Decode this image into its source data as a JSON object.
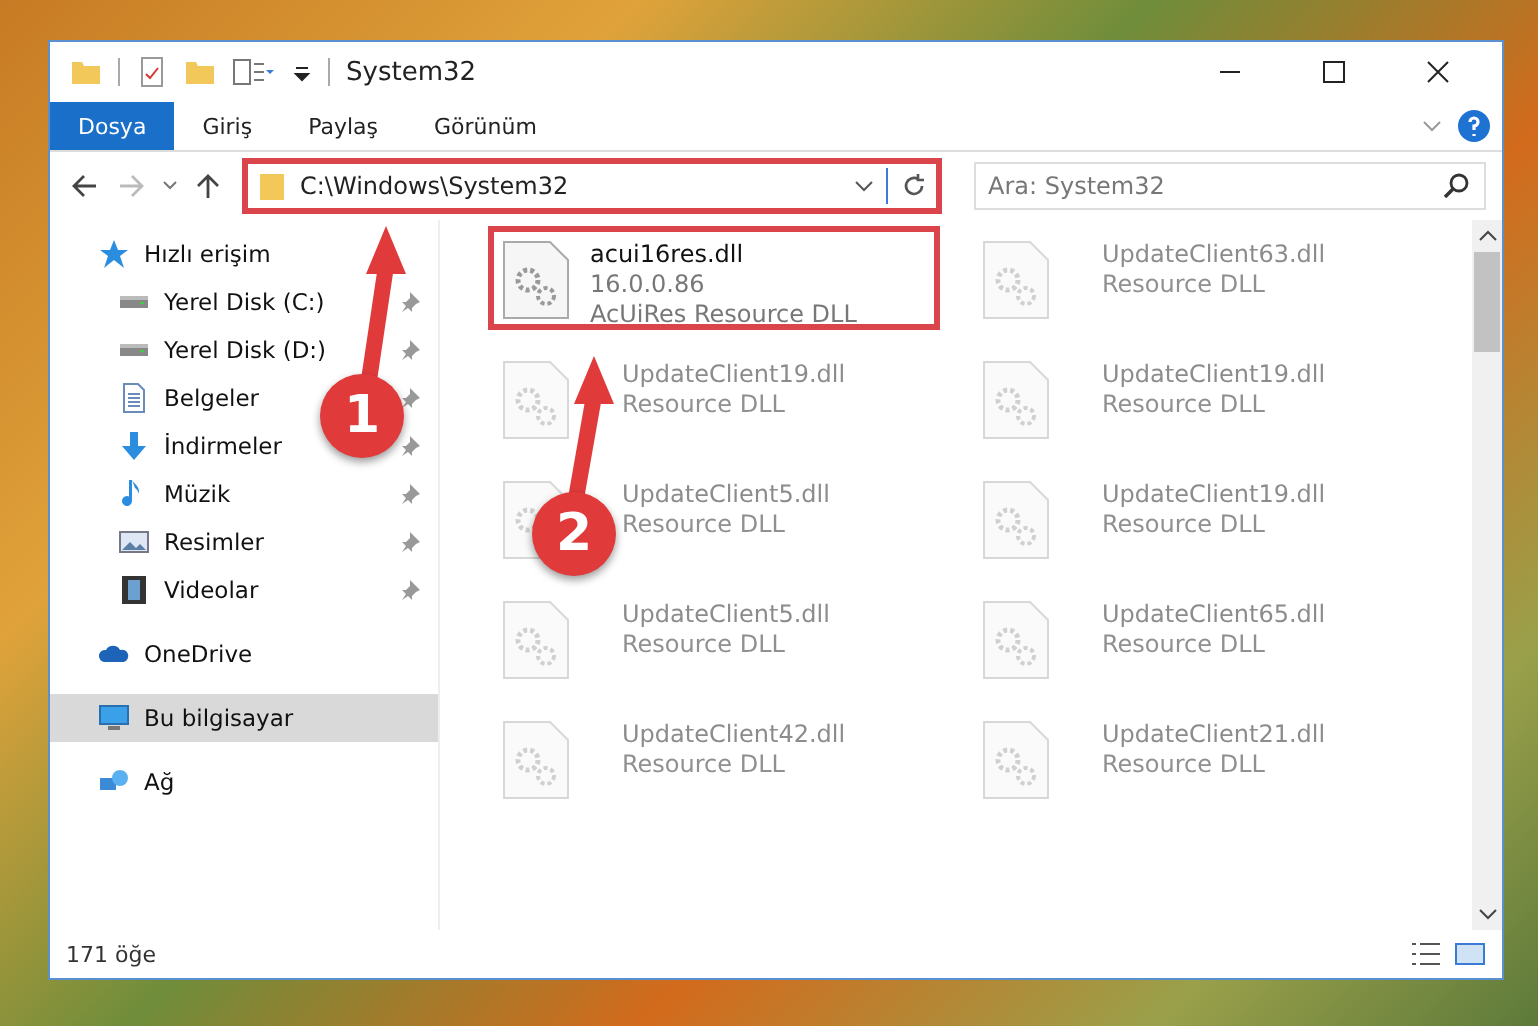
{
  "window": {
    "title": "System32"
  },
  "ribbon_tabs": [
    {
      "label": "Dosya",
      "selected": true
    },
    {
      "label": "Giriş",
      "selected": false
    },
    {
      "label": "Paylaş",
      "selected": false
    },
    {
      "label": "Görünüm",
      "selected": false
    }
  ],
  "address_bar": {
    "path": "C:\\Windows\\System32",
    "highlighted": true
  },
  "search": {
    "placeholder": "Ara: System32"
  },
  "sidebar": {
    "items": [
      {
        "label": "Hızlı erişim",
        "kind": "star",
        "selected": false,
        "children": [
          {
            "label": "Yerel Disk (C:)",
            "kind": "drive",
            "pinned": true,
            "selected": false
          },
          {
            "label": "Yerel Disk (D:)",
            "kind": "drive",
            "pinned": true,
            "selected": false
          },
          {
            "label": "Belgeler",
            "kind": "document",
            "pinned": true,
            "selected": false
          },
          {
            "label": "İndirmeler",
            "kind": "download",
            "pinned": true,
            "selected": false
          },
          {
            "label": "Müzik",
            "kind": "music",
            "pinned": true,
            "selected": false
          },
          {
            "label": "Resimler",
            "kind": "picture",
            "pinned": true,
            "selected": false
          },
          {
            "label": "Videolar",
            "kind": "video",
            "pinned": true,
            "selected": false
          }
        ]
      },
      {
        "label": "OneDrive",
        "kind": "cloud",
        "selected": false
      },
      {
        "label": "Bu bilgisayar",
        "kind": "computer",
        "selected": true
      },
      {
        "label": "Ağ",
        "kind": "network",
        "selected": false
      }
    ]
  },
  "files": [
    {
      "name": "acui16res.dll",
      "version": "16.0.0.86",
      "description": "AcUiRes Resource DLL",
      "highlighted": true,
      "faded": false
    },
    {
      "name": "UpdateClient63.dll",
      "description": "Resource DLL",
      "faded": true
    },
    {
      "name": "UpdateClient19.dll",
      "description": "Resource DLL",
      "faded": true
    },
    {
      "name": "UpdateClient19.dll",
      "description": "Resource DLL",
      "faded": true
    },
    {
      "name": "UpdateClient5.dll",
      "description": "Resource DLL",
      "faded": true
    },
    {
      "name": "UpdateClient19.dll",
      "description": "Resource DLL",
      "faded": true
    },
    {
      "name": "UpdateClient5.dll",
      "description": "Resource DLL",
      "faded": true
    },
    {
      "name": "UpdateClient65.dll",
      "description": "Resource DLL",
      "faded": true
    },
    {
      "name": "UpdateClient42.dll",
      "description": "Resource DLL",
      "faded": true
    },
    {
      "name": "UpdateClient21.dll",
      "description": "Resource DLL",
      "faded": true
    }
  ],
  "status_bar": {
    "count": "171 öğe"
  },
  "annotations": [
    {
      "label": "1"
    },
    {
      "label": "2"
    }
  ]
}
